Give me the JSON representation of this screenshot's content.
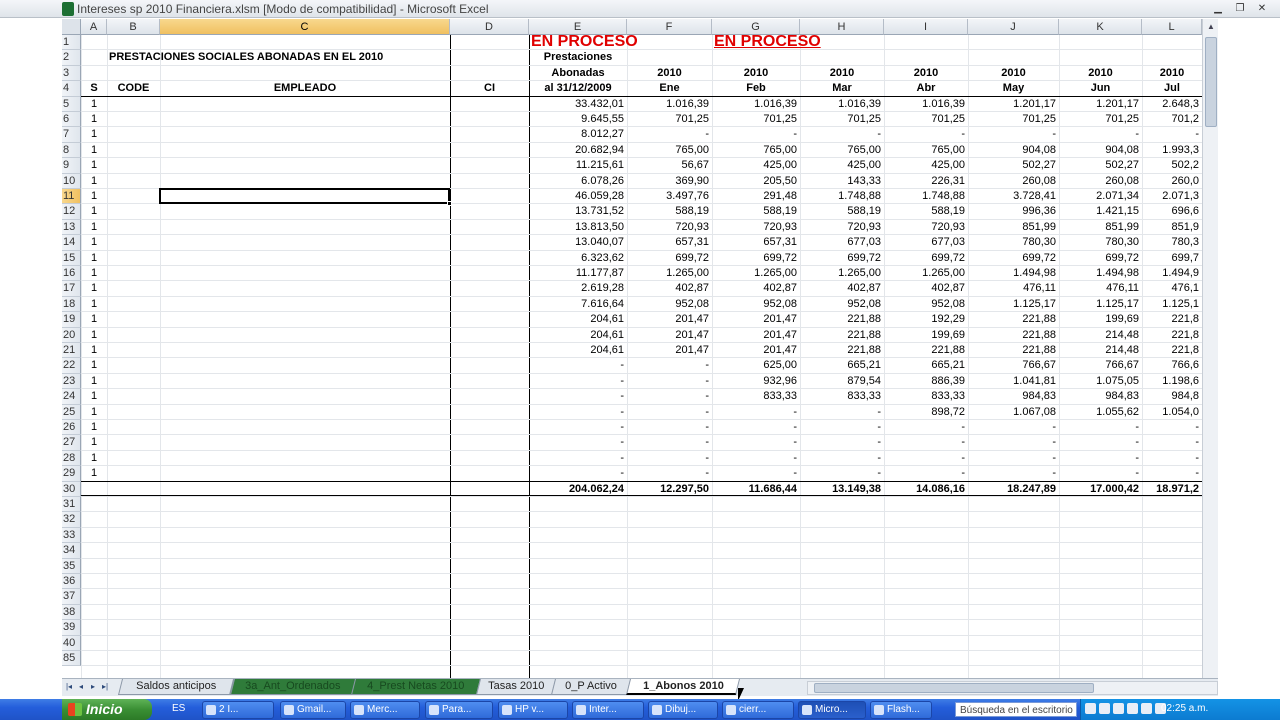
{
  "window": {
    "title": "Intereses sp 2010 Financiera.xlsm  [Modo de compatibilidad] - Microsoft Excel",
    "minimize": "▁",
    "restore": "❐",
    "close": "✕"
  },
  "columns": [
    "A",
    "B",
    "C",
    "D",
    "E",
    "F",
    "G",
    "H",
    "I",
    "J",
    "K",
    "L"
  ],
  "selected_cell": "C11",
  "header": {
    "in_process_1": "EN PROCESO",
    "in_process_2": "EN PROCESO",
    "title": "PRESTACIONES SOCIALES ABONADAS EN EL 2010",
    "e2": "Prestaciones",
    "e3": "Abonadas",
    "e4": "al 31/12/2009",
    "year": "2010",
    "col_s": "S",
    "col_code": "CODE",
    "col_empleado": "EMPLEADO",
    "col_ci": "CI",
    "months": [
      "Ene",
      "Feb",
      "Mar",
      "Abr",
      "May",
      "Jun",
      "Jul"
    ]
  },
  "rows": [
    {
      "n": "5",
      "s": "1",
      "v": [
        "33.432,01",
        "1.016,39",
        "1.016,39",
        "1.016,39",
        "1.016,39",
        "1.201,17",
        "1.201,17",
        "2.648,3"
      ]
    },
    {
      "n": "6",
      "s": "1",
      "v": [
        "9.645,55",
        "701,25",
        "701,25",
        "701,25",
        "701,25",
        "701,25",
        "701,25",
        "701,2"
      ]
    },
    {
      "n": "7",
      "s": "1",
      "v": [
        "8.012,27",
        "-",
        "-",
        "-",
        "-",
        "-",
        "-",
        "-"
      ]
    },
    {
      "n": "8",
      "s": "1",
      "v": [
        "20.682,94",
        "765,00",
        "765,00",
        "765,00",
        "765,00",
        "904,08",
        "904,08",
        "1.993,3"
      ]
    },
    {
      "n": "9",
      "s": "1",
      "v": [
        "11.215,61",
        "56,67",
        "425,00",
        "425,00",
        "425,00",
        "502,27",
        "502,27",
        "502,2"
      ]
    },
    {
      "n": "10",
      "s": "1",
      "v": [
        "6.078,26",
        "369,90",
        "205,50",
        "143,33",
        "226,31",
        "260,08",
        "260,08",
        "260,0"
      ]
    },
    {
      "n": "11",
      "s": "1",
      "v": [
        "46.059,28",
        "3.497,76",
        "291,48",
        "1.748,88",
        "1.748,88",
        "3.728,41",
        "2.071,34",
        "2.071,3"
      ]
    },
    {
      "n": "12",
      "s": "1",
      "v": [
        "13.731,52",
        "588,19",
        "588,19",
        "588,19",
        "588,19",
        "996,36",
        "1.421,15",
        "696,6"
      ]
    },
    {
      "n": "13",
      "s": "1",
      "v": [
        "13.813,50",
        "720,93",
        "720,93",
        "720,93",
        "720,93",
        "851,99",
        "851,99",
        "851,9"
      ]
    },
    {
      "n": "14",
      "s": "1",
      "v": [
        "13.040,07",
        "657,31",
        "657,31",
        "677,03",
        "677,03",
        "780,30",
        "780,30",
        "780,3"
      ]
    },
    {
      "n": "15",
      "s": "1",
      "v": [
        "6.323,62",
        "699,72",
        "699,72",
        "699,72",
        "699,72",
        "699,72",
        "699,72",
        "699,7"
      ]
    },
    {
      "n": "16",
      "s": "1",
      "v": [
        "11.177,87",
        "1.265,00",
        "1.265,00",
        "1.265,00",
        "1.265,00",
        "1.494,98",
        "1.494,98",
        "1.494,9"
      ]
    },
    {
      "n": "17",
      "s": "1",
      "v": [
        "2.619,28",
        "402,87",
        "402,87",
        "402,87",
        "402,87",
        "476,11",
        "476,11",
        "476,1"
      ]
    },
    {
      "n": "18",
      "s": "1",
      "v": [
        "7.616,64",
        "952,08",
        "952,08",
        "952,08",
        "952,08",
        "1.125,17",
        "1.125,17",
        "1.125,1"
      ]
    },
    {
      "n": "19",
      "s": "1",
      "v": [
        "204,61",
        "201,47",
        "201,47",
        "221,88",
        "192,29",
        "221,88",
        "199,69",
        "221,8"
      ]
    },
    {
      "n": "20",
      "s": "1",
      "v": [
        "204,61",
        "201,47",
        "201,47",
        "221,88",
        "199,69",
        "221,88",
        "214,48",
        "221,8"
      ]
    },
    {
      "n": "21",
      "s": "1",
      "v": [
        "204,61",
        "201,47",
        "201,47",
        "221,88",
        "221,88",
        "221,88",
        "214,48",
        "221,8"
      ]
    },
    {
      "n": "22",
      "s": "1",
      "v": [
        "-",
        "-",
        "625,00",
        "665,21",
        "665,21",
        "766,67",
        "766,67",
        "766,6"
      ]
    },
    {
      "n": "23",
      "s": "1",
      "v": [
        "-",
        "-",
        "932,96",
        "879,54",
        "886,39",
        "1.041,81",
        "1.075,05",
        "1.198,6"
      ]
    },
    {
      "n": "24",
      "s": "1",
      "v": [
        "-",
        "-",
        "833,33",
        "833,33",
        "833,33",
        "984,83",
        "984,83",
        "984,8"
      ]
    },
    {
      "n": "25",
      "s": "1",
      "v": [
        "-",
        "-",
        "-",
        "-",
        "898,72",
        "1.067,08",
        "1.055,62",
        "1.054,0"
      ]
    },
    {
      "n": "26",
      "s": "1",
      "v": [
        "-",
        "-",
        "-",
        "-",
        "-",
        "-",
        "-",
        "-"
      ]
    },
    {
      "n": "27",
      "s": "1",
      "v": [
        "-",
        "-",
        "-",
        "-",
        "-",
        "-",
        "-",
        "-"
      ]
    },
    {
      "n": "28",
      "s": "1",
      "v": [
        "-",
        "-",
        "-",
        "-",
        "-",
        "-",
        "-",
        "-"
      ]
    },
    {
      "n": "29",
      "s": "1",
      "v": [
        "-",
        "-",
        "-",
        "-",
        "-",
        "-",
        "-",
        "-"
      ]
    }
  ],
  "totals": {
    "n": "30",
    "v": [
      "204.062,24",
      "12.297,50",
      "11.686,44",
      "13.149,38",
      "14.086,16",
      "18.247,89",
      "17.000,42",
      "18.971,2"
    ]
  },
  "header_rows": [
    "1",
    "2",
    "3",
    "4"
  ],
  "empty_rows": [
    "31",
    "32",
    "33",
    "34",
    "35",
    "36",
    "37",
    "38",
    "39",
    "40",
    "85"
  ],
  "sheet_nav": [
    "|◂",
    "◂",
    "▸",
    "▸|"
  ],
  "sheet_tabs": [
    {
      "label": "Saldos anticipos",
      "style": "normal"
    },
    {
      "label": "3a_Ant_Ordenados",
      "style": "green"
    },
    {
      "label": "4_Prest Netas 2010",
      "style": "green"
    },
    {
      "label": "Tasas 2010",
      "style": "normal"
    },
    {
      "label": "0_P Activo",
      "style": "normal"
    },
    {
      "label": "1_Abonos 2010",
      "style": "active"
    }
  ],
  "taskbar": {
    "start": "Inicio",
    "lang": "ES",
    "tasks": [
      "2 I...",
      "Gmail...",
      "Merc...",
      "Para...",
      "HP v...",
      "Inter...",
      "Dibuj...",
      "cierr...",
      "Micro...",
      "Flash..."
    ],
    "search_placeholder": "Búsqueda en el escritorio",
    "clock": "02:25 a.m."
  }
}
